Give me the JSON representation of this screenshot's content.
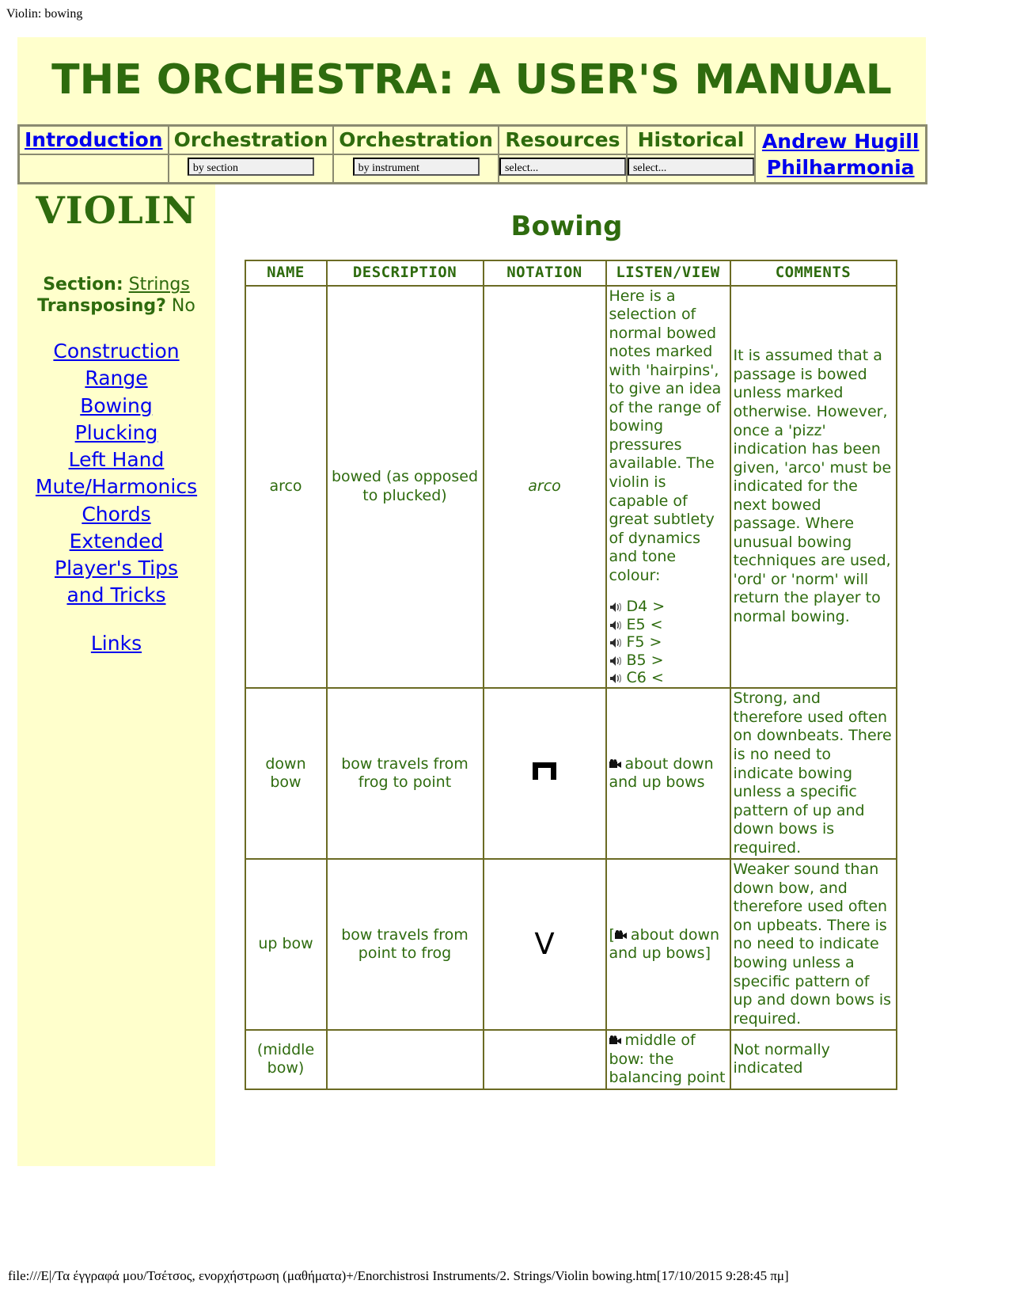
{
  "print_header": "Violin: bowing",
  "banner": "THE ORCHESTRA: A USER'S MANUAL",
  "nav": {
    "cells": [
      {
        "label": "Introduction",
        "is_link": true,
        "select": null
      },
      {
        "label": "Orchestration",
        "is_link": false,
        "select": "by section"
      },
      {
        "label": "Orchestration",
        "is_link": false,
        "select": "by instrument"
      },
      {
        "label": "Resources",
        "is_link": false,
        "select": "select..."
      },
      {
        "label": "Historical",
        "is_link": false,
        "select": "select..."
      }
    ],
    "credit_line1": "Andrew Hugill",
    "credit_line2": "Philharmonia"
  },
  "sidebar": {
    "instrument": "VIOLIN",
    "section_label": "Section:",
    "section_value": "Strings",
    "transposing_label": "Transposing?",
    "transposing_value": "No",
    "links": [
      "Construction",
      "Range",
      "Bowing",
      "Plucking",
      "Left Hand",
      "Mute/Harmonics",
      "Chords",
      "Extended",
      "Player's Tips",
      "and Tricks"
    ],
    "links_after_gap": [
      "Links"
    ]
  },
  "main": {
    "section_title": "Bowing",
    "table": {
      "headers": [
        "NAME",
        "DESCRIPTION",
        "NOTATION",
        "LISTEN/VIEW",
        "COMMENTS"
      ],
      "rows": [
        {
          "name": "arco",
          "description": "bowed (as opposed to plucked)",
          "notation": "arco",
          "notation_style": "italic",
          "listen_intro": "Here is a selection of normal bowed notes marked with 'hairpins', to give an idea of the range of bowing pressures available. The violin is capable of great subtlety of dynamics and tone colour:",
          "listen_items": [
            {
              "icon": "speaker-icon",
              "label": "D4 >"
            },
            {
              "icon": "speaker-icon",
              "label": "E5 <"
            },
            {
              "icon": "speaker-icon",
              "label": "F5 >"
            },
            {
              "icon": "speaker-icon",
              "label": "B5 >"
            },
            {
              "icon": "speaker-icon",
              "label": "C6 <"
            }
          ],
          "comments": "It is assumed that a passage is bowed unless marked otherwise. However, once a 'pizz' indication has been given, 'arco' must be indicated for the next bowed passage. Where unusual bowing techniques are used, 'ord' or 'norm' will return the player to normal bowing."
        },
        {
          "name": "down bow",
          "description": "bow travels from frog to point",
          "notation": "∏",
          "notation_style": "downbow",
          "listen_prefix": "",
          "listen_icon": "video-camera-icon",
          "listen_text": "about down and up bows",
          "listen_suffix": "",
          "comments": "Strong, and therefore used often on downbeats. There is no need to indicate bowing unless a specific pattern of up and down bows is required."
        },
        {
          "name": "up bow",
          "description": "bow travels from point to frog",
          "notation": "V",
          "notation_style": "upbow",
          "listen_prefix": "[",
          "listen_icon": "video-camera-icon",
          "listen_text": "about down and up bows",
          "listen_suffix": "]",
          "comments": "Weaker sound than down bow, and therefore used often on upbeats. There is no need to indicate bowing unless a specific pattern of up and down bows is required."
        },
        {
          "name": "(middle bow)",
          "description": "",
          "notation": "",
          "notation_style": "none",
          "listen_prefix": "",
          "listen_icon": "video-camera-icon",
          "listen_text": "middle of bow: the balancing point",
          "listen_suffix": "",
          "comments": "Not normally indicated"
        }
      ]
    }
  },
  "footer": "file:///E|/Τα έγγραφά μου/Τσέτσος, ενορχήστρωση (μαθήματα)+/Enorchistrosi Instruments/2. Strings/Violin  bowing.htm[17/10/2015 9:28:45 πμ]",
  "colors": {
    "page_bg": "#ffffcc",
    "green": "#2e6b0e",
    "link_blue": "#0000ee",
    "table_border": "#6b6b24",
    "nav_border": "#8a8a70"
  }
}
